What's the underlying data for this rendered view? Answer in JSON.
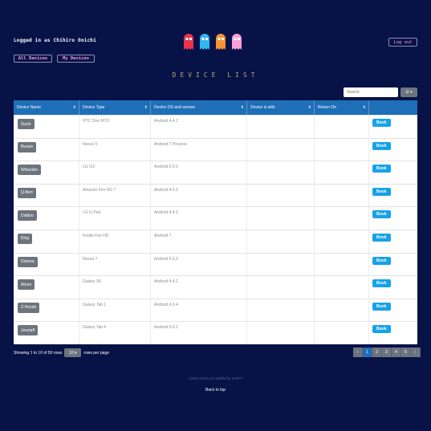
{
  "header": {
    "logged_in_text": "Logged in as Chihiro Onichi",
    "logout_label": "Log out",
    "nav": {
      "all_label": "All Devices",
      "my_label": "My Devices"
    },
    "ghost_colors": [
      "#e8344c",
      "#33b6f0",
      "#f59235",
      "#f7a0d8"
    ]
  },
  "page_title": "DEVICE LIST",
  "toolbar": {
    "search_placeholder": "Search"
  },
  "table": {
    "columns": [
      "Device Name",
      "Device Type",
      "Device OS and version",
      "Device is with",
      "Return On",
      ""
    ],
    "book_label": "Book",
    "rows": [
      {
        "name": "Suzie",
        "type": "HTC One M7/2",
        "os": "Android 4.4.2"
      },
      {
        "name": "Busuin",
        "type": "Nexus 5",
        "os": "Android 7 Preview"
      },
      {
        "name": "Whizzikin",
        "type": "LG G3",
        "os": "Android 5.0.0"
      },
      {
        "name": "Q-Bert",
        "type": "Amazon Fire HD 7",
        "os": "Android 4.5.5"
      },
      {
        "name": "Diddoo",
        "type": "LG G Pad",
        "os": "Android 4.4.2"
      },
      {
        "name": "King",
        "type": "Kindle Fire HD",
        "os": "Android 7"
      },
      {
        "name": "Dionisa",
        "type": "Nexus 7",
        "os": "Android 5.0.2"
      },
      {
        "name": "Ahren",
        "type": "Galaxy S6",
        "os": "Android 4.4.2"
      },
      {
        "name": "Z-Hondo",
        "type": "Galaxy Tab 1",
        "os": "Android 4.0.4"
      },
      {
        "name": "Jonslaff",
        "type": "Galaxy Tab 4",
        "os": "Android 5.0.2"
      }
    ]
  },
  "pagination": {
    "showing_text": "Showing 1 to 10 of 50 rows",
    "per_page_value": "10",
    "per_page_suffix": "rows per page",
    "pages": [
      "‹",
      "1",
      "2",
      "3",
      "4",
      "5",
      "›"
    ],
    "active_page": "1"
  },
  "footer": {
    "text": "©2020 MOSAIC Mobile by SWiFT",
    "back_to_top": "Back to top"
  }
}
